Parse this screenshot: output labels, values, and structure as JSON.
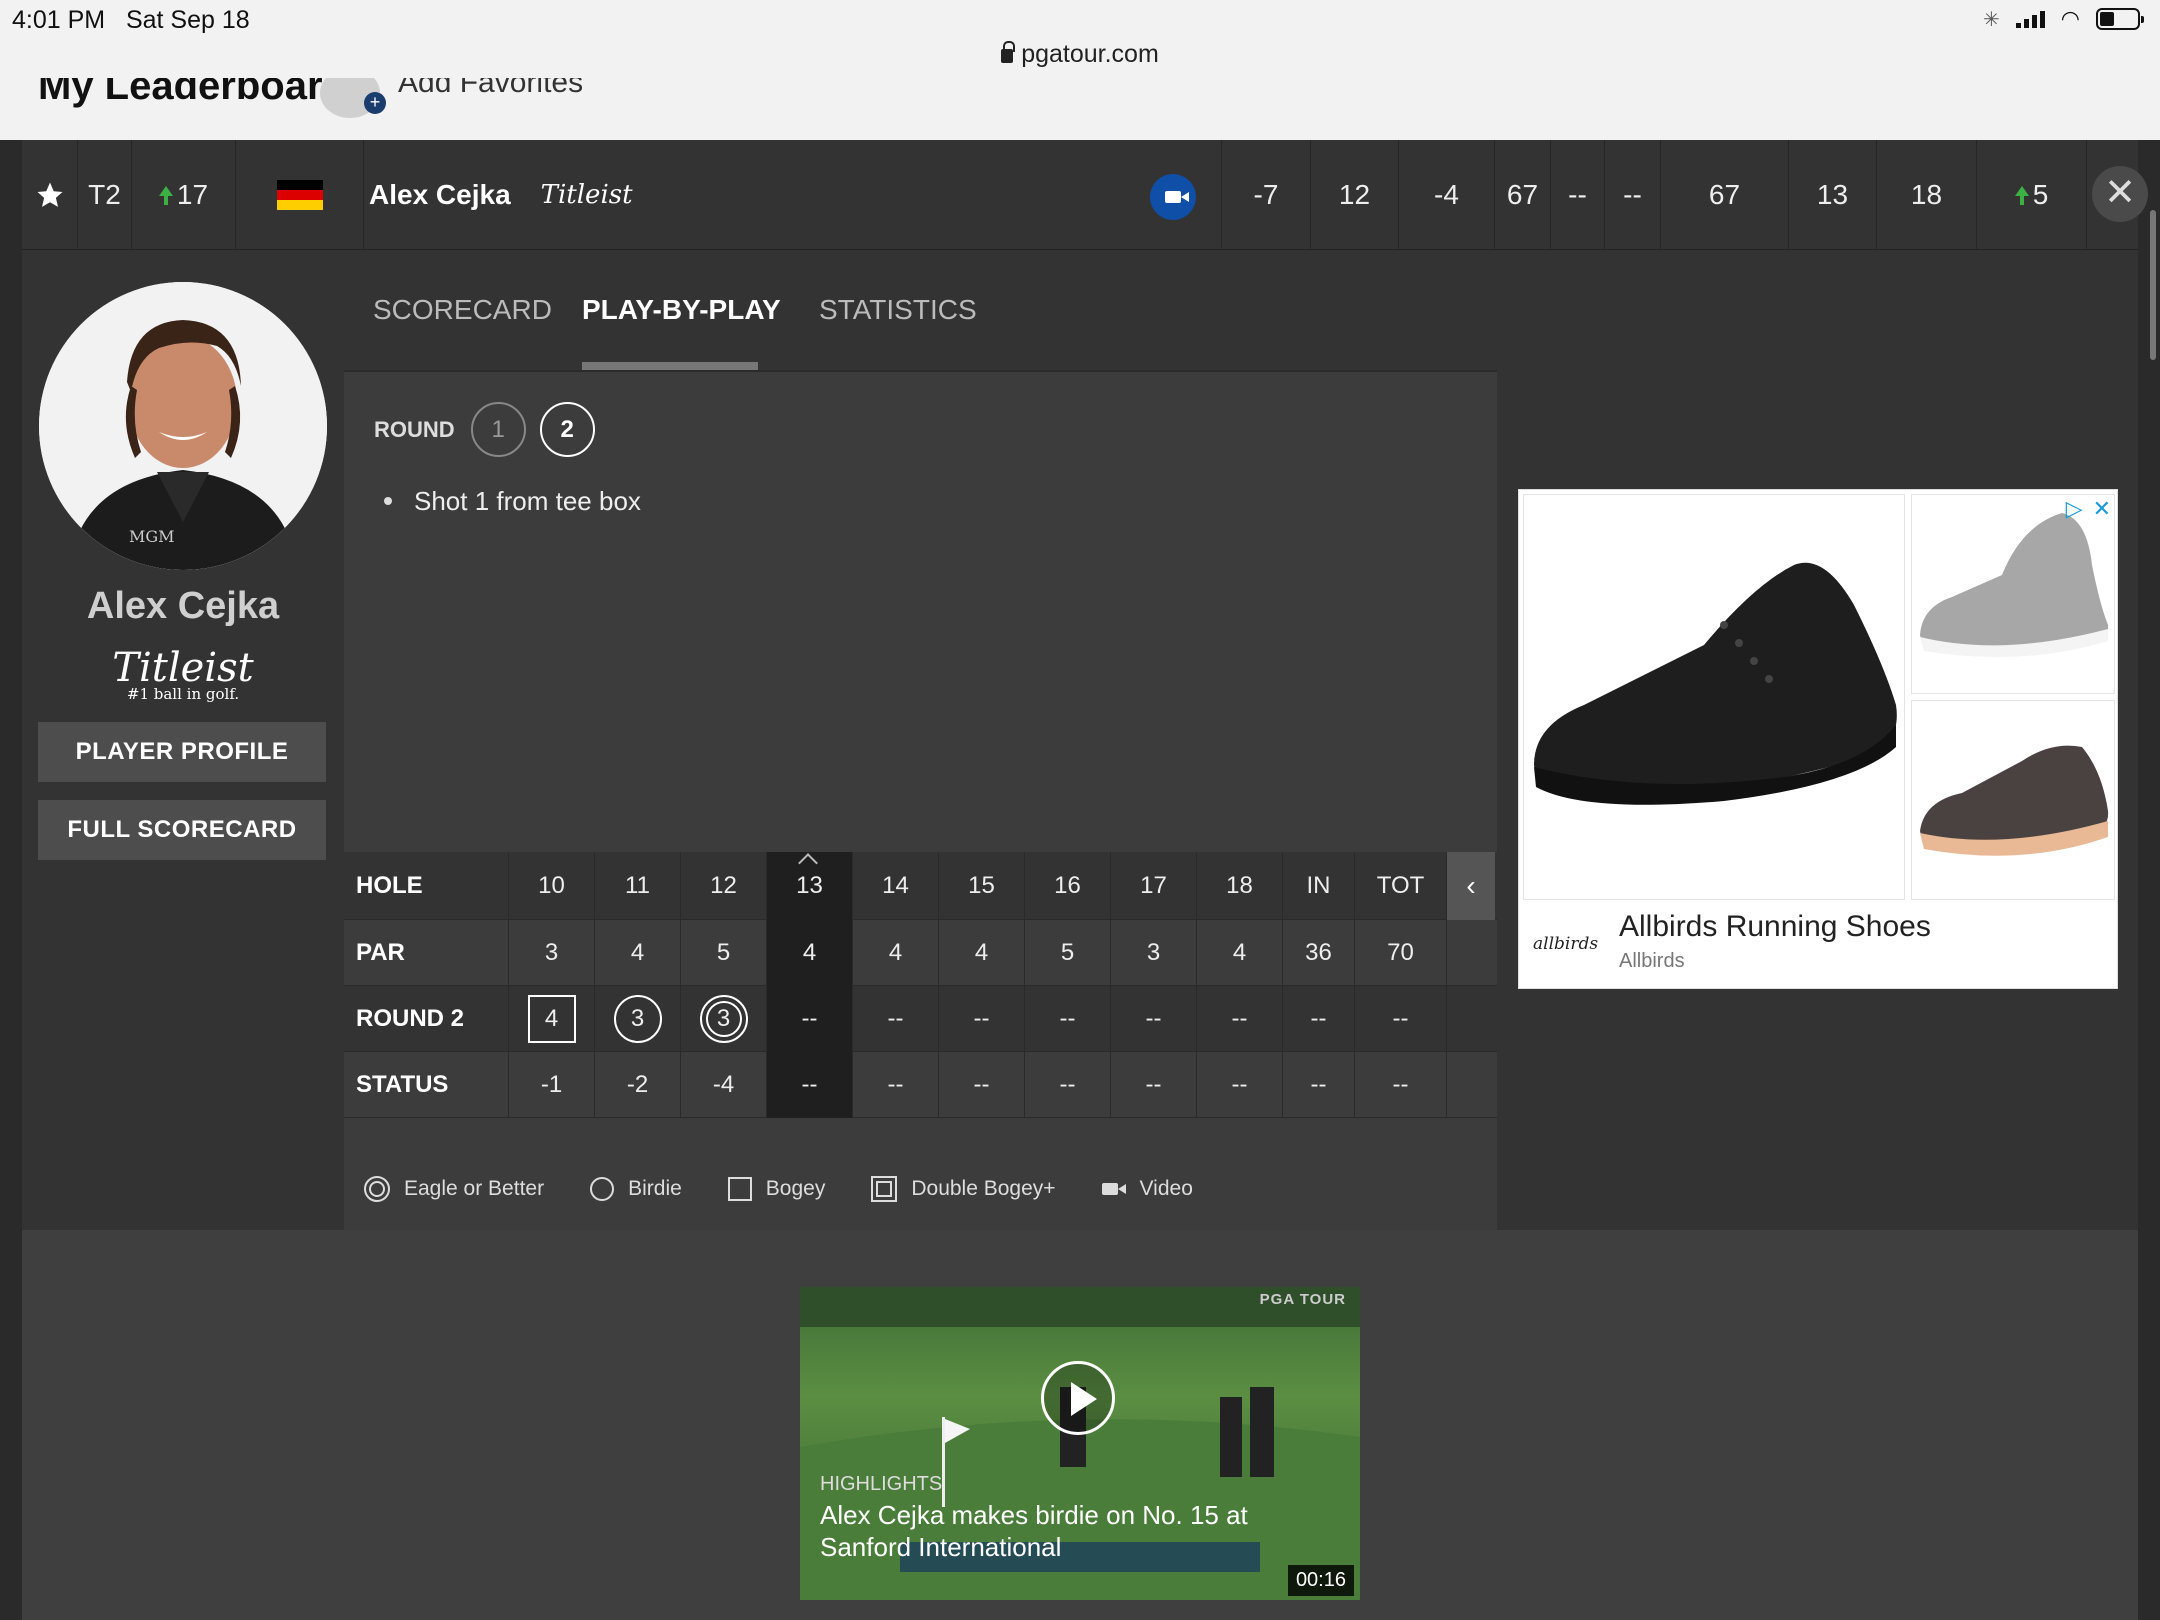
{
  "status_bar": {
    "time": "4:01 PM",
    "date": "Sat Sep 18",
    "url": "pgatour.com"
  },
  "top_strip": {
    "title": "My Leaderboard",
    "favorites": "Add Favorites"
  },
  "player_row": {
    "position": "T2",
    "move": "17",
    "name": "Alex Cejka",
    "sponsor": "Titleist",
    "cells": [
      "-7",
      "12",
      "-4",
      "67",
      "--",
      "--",
      "67",
      "13",
      "18"
    ],
    "projected_move": "5",
    "flag_colors": [
      "#000000",
      "#dd0000",
      "#ffce00"
    ]
  },
  "left_panel": {
    "name": "Alex Cejka",
    "sponsor": "Titleist",
    "sponsor_tagline": "#1 ball in golf.",
    "player_profile": "PLAYER PROFILE",
    "full_scorecard": "FULL SCORECARD"
  },
  "tabs": {
    "scorecard": "SCORECARD",
    "play_by_play": "PLAY-BY-PLAY",
    "statistics": "STATISTICS"
  },
  "round": {
    "label": "ROUND",
    "r1": "1",
    "r2": "2"
  },
  "play_by_play": [
    "Shot 1 from tee box"
  ],
  "scorecard": {
    "hole_label": "HOLE",
    "par_label": "PAR",
    "round_label": "ROUND 2",
    "status_label": "STATUS",
    "holes": [
      "10",
      "11",
      "12",
      "13",
      "14",
      "15",
      "16",
      "17",
      "18",
      "IN",
      "TOT"
    ],
    "par": [
      "3",
      "4",
      "5",
      "4",
      "4",
      "4",
      "5",
      "3",
      "4",
      "36",
      "70"
    ],
    "round2": [
      "4",
      "3",
      "3",
      "--",
      "--",
      "--",
      "--",
      "--",
      "--",
      "--",
      "--"
    ],
    "status": [
      "-1",
      "-2",
      "-4",
      "--",
      "--",
      "--",
      "--",
      "--",
      "--",
      "--",
      "--"
    ]
  },
  "legend": {
    "eagle": "Eagle or Better",
    "birdie": "Birdie",
    "bogey": "Bogey",
    "double": "Double Bogey+",
    "video": "Video"
  },
  "ad": {
    "title": "Allbirds Running Shoes",
    "sub": "Allbirds",
    "brand": "allbirds"
  },
  "video": {
    "label": "HIGHLIGHTS",
    "title": "Alex Cejka makes birdie on No. 15 at Sanford International",
    "duration": "00:16",
    "brand": "PGA TOUR"
  }
}
